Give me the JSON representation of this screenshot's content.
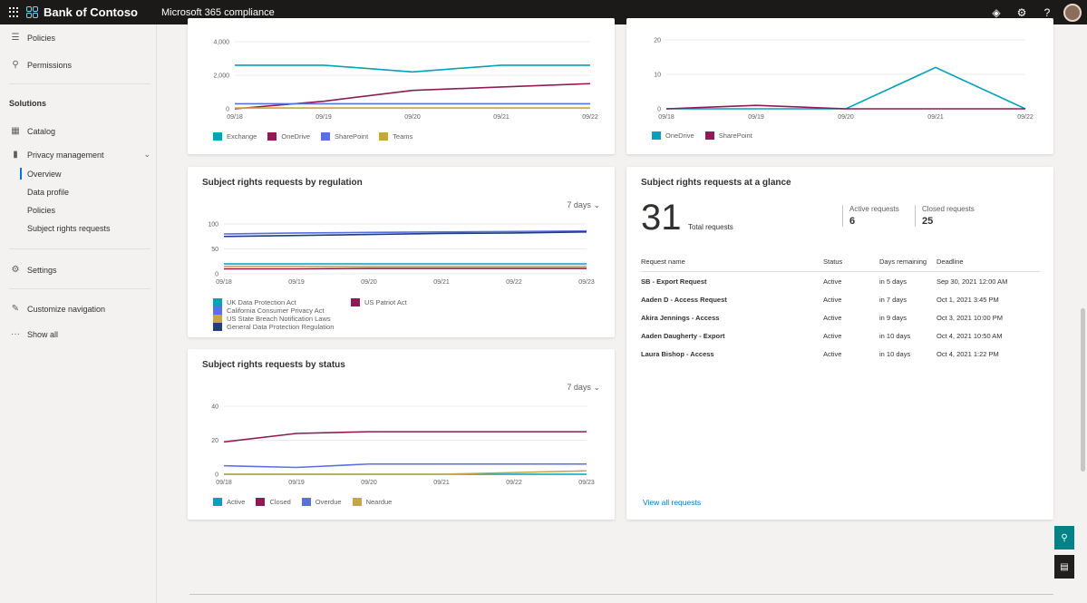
{
  "topbar": {
    "brand": "Bank of Contoso",
    "app_title": "Microsoft 365 compliance",
    "icons": [
      "diamond-icon",
      "gear-icon",
      "help-icon"
    ]
  },
  "sidebar": {
    "items": [
      {
        "label": "Policies",
        "icon": "policies-icon"
      },
      {
        "label": "Permissions",
        "icon": "permissions-icon"
      },
      {
        "section": "Solutions"
      },
      {
        "label": "Catalog",
        "icon": "catalog-icon"
      },
      {
        "label": "Privacy management",
        "icon": "privacy-icon"
      },
      {
        "sub": "Overview"
      },
      {
        "sub": "Data profile"
      },
      {
        "sub": "Policies"
      },
      {
        "sub": "Subject rights requests"
      },
      {
        "label": "Settings",
        "icon": "gear-icon"
      },
      {
        "label": "Customize navigation",
        "icon": "pencil-icon"
      },
      {
        "label": "Show all",
        "icon": "ellipsis-icon"
      }
    ]
  },
  "cards": {
    "top_left": {
      "legend": [
        "Exchange",
        "OneDrive",
        "SharePoint",
        "Teams"
      ],
      "chart_data": {
        "type": "line",
        "x": [
          "09/18",
          "09/19",
          "09/20",
          "09/21",
          "09/22"
        ],
        "yticks": [
          "4,000",
          "2,000",
          "0"
        ],
        "ylim": [
          0,
          4000
        ],
        "series": [
          {
            "name": "Exchange",
            "color": "#00a2b8",
            "values": [
              2600,
              2600,
              2200,
              2600,
              2600
            ]
          },
          {
            "name": "OneDrive",
            "color": "#8e1b55",
            "values": [
              0,
              450,
              1100,
              1300,
              1500
            ]
          },
          {
            "name": "SharePoint",
            "color": "#5a6fe6",
            "values": [
              300,
              300,
              300,
              300,
              300
            ]
          },
          {
            "name": "Teams",
            "color": "#c6a73e",
            "values": [
              50,
              50,
              50,
              50,
              50
            ]
          }
        ]
      }
    },
    "top_right": {
      "legend": [
        "OneDrive",
        "SharePoint"
      ],
      "chart_data": {
        "type": "line",
        "x": [
          "09/18",
          "09/19",
          "09/20",
          "09/21",
          "09/22"
        ],
        "yticks": [
          "20",
          "10",
          "0"
        ],
        "ylim": [
          0,
          20
        ],
        "series": [
          {
            "name": "OneDrive",
            "color": "#00a2b8",
            "values": [
              0,
              0,
              0,
              12,
              0
            ]
          },
          {
            "name": "SharePoint",
            "color": "#8e1b55",
            "values": [
              0,
              1,
              0,
              0,
              0
            ]
          }
        ]
      }
    },
    "regulation": {
      "title": "Subject rights requests by regulation",
      "range": "7 days",
      "legend": [
        "UK Data Protection Act",
        "US Patriot Act",
        "California Consumer Privacy Act",
        "US State Breach Notification Laws",
        "General Data Protection Regulation"
      ],
      "chart_data": {
        "type": "line",
        "x": [
          "09/18",
          "09/19",
          "09/20",
          "09/21",
          "09/22",
          "09/23"
        ],
        "yticks": [
          "100",
          "50",
          "0"
        ],
        "ylim": [
          0,
          100
        ],
        "series": [
          {
            "name": "UK Data Protection Act",
            "color": "#00a2b8",
            "values": [
              20,
              20,
              20,
              20,
              20,
              20
            ]
          },
          {
            "name": "US Patriot Act",
            "color": "#8e1b55",
            "values": [
              10,
              10,
              11,
              11,
              11,
              11
            ]
          },
          {
            "name": "California Consumer Privacy Act",
            "color": "#5a6fe6",
            "values": [
              80,
              82,
              83,
              84,
              85,
              86
            ]
          },
          {
            "name": "US State Breach Notification Laws",
            "color": "#c6a73e",
            "values": [
              15,
              15,
              15,
              15,
              15,
              15
            ]
          },
          {
            "name": "General Data Protection Regulation",
            "color": "#1f3f7a",
            "values": [
              75,
              77,
              79,
              81,
              82,
              84
            ]
          }
        ]
      }
    },
    "status": {
      "title": "Subject rights requests by status",
      "range": "7 days",
      "legend": [
        "Active",
        "Closed",
        "Overdue",
        "Neardue"
      ],
      "chart_data": {
        "type": "line",
        "x": [
          "09/18",
          "09/19",
          "09/20",
          "09/21",
          "09/22",
          "09/23"
        ],
        "yticks": [
          "40",
          "20",
          "0"
        ],
        "ylim": [
          0,
          40
        ],
        "series": [
          {
            "name": "Active",
            "color": "#00a2b8",
            "values": [
              0,
              0,
              0,
              0,
              0,
              0
            ]
          },
          {
            "name": "Closed",
            "color": "#8e1b55",
            "values": [
              19,
              24,
              25,
              25,
              25,
              25
            ]
          },
          {
            "name": "Overdue",
            "color": "#5a6fe6",
            "values": [
              5,
              4,
              6,
              6,
              6,
              6
            ]
          },
          {
            "name": "Neardue",
            "color": "#c6a73e",
            "values": [
              0,
              0,
              0,
              0,
              1,
              2
            ]
          }
        ]
      }
    },
    "glance": {
      "title": "Subject rights requests at a glance",
      "total": "31",
      "total_label": "Total requests",
      "active_label": "Active requests",
      "active_value": "6",
      "closed_label": "Closed requests",
      "closed_value": "25",
      "columns": [
        "Request name",
        "Status",
        "Days remaining",
        "Deadline"
      ],
      "rows": [
        [
          "SB - Export Request",
          "Active",
          "in 5 days",
          "Sep 30, 2021 12:00 AM"
        ],
        [
          "Aaden D - Access Request",
          "Active",
          "in 7 days",
          "Oct 1, 2021 3:45 PM"
        ],
        [
          "Akira Jennings - Access",
          "Active",
          "in 9 days",
          "Oct 3, 2021 10:00 PM"
        ],
        [
          "Aaden Daugherty - Export",
          "Active",
          "in 10 days",
          "Oct 4, 2021 10:50 AM"
        ],
        [
          "Laura Bishop - Access",
          "Active",
          "in 10 days",
          "Oct 4, 2021 1:22 PM"
        ]
      ],
      "view_all": "View all requests"
    }
  }
}
